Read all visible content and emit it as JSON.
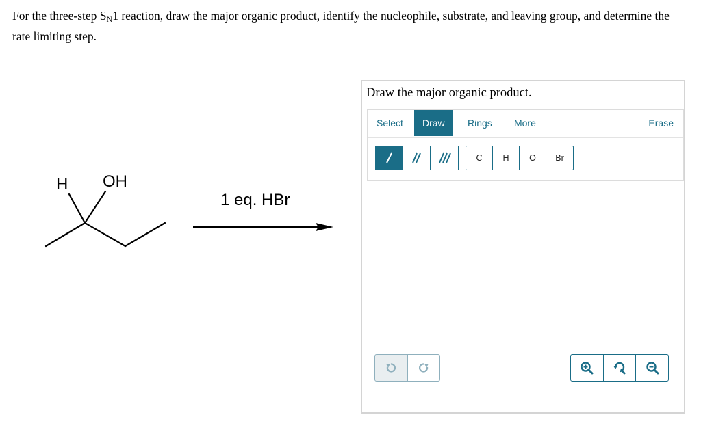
{
  "question": {
    "text_before": "For the three-step S",
    "sub": "N",
    "text_after": "1 reaction, draw the major organic product, identify the nucleophile, substrate, and leaving group, and determine the rate limiting step."
  },
  "scheme": {
    "atom_h": "H",
    "atom_oh": "OH",
    "reagent": "1 eq. HBr"
  },
  "widget": {
    "prompt": "Draw the major organic product.",
    "tabs": {
      "select": "Select",
      "draw": "Draw",
      "rings": "Rings",
      "more": "More",
      "erase": "Erase"
    },
    "active_tab": "Draw",
    "bonds": [
      "single-bond",
      "double-bond",
      "triple-bond"
    ],
    "active_bond": "single-bond",
    "atoms": [
      "C",
      "H",
      "O",
      "Br"
    ],
    "colors": {
      "accent": "#1a6d87",
      "border": "#d4d4d4",
      "disabled": "#8fb0bd"
    }
  }
}
